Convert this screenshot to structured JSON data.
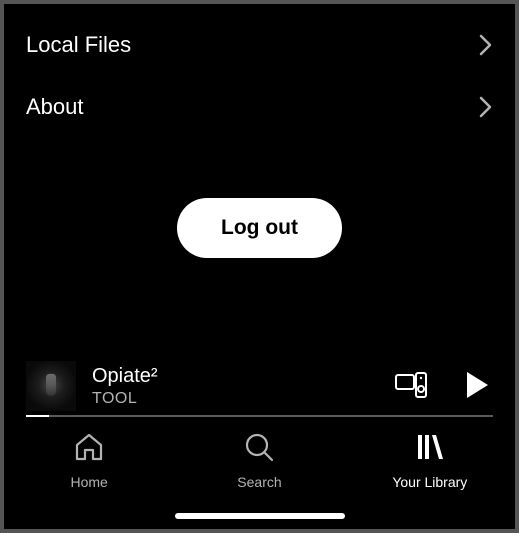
{
  "settings": {
    "items": [
      {
        "label": "Local Files"
      },
      {
        "label": "About"
      }
    ],
    "logout_label": "Log out"
  },
  "now_playing": {
    "title": "Opiate²",
    "artist": "TOOL",
    "progress_percent": 5
  },
  "nav": {
    "home": "Home",
    "search": "Search",
    "library": "Your Library",
    "active": "library"
  },
  "colors": {
    "background": "#000000",
    "text_primary": "#ffffff",
    "text_secondary": "#b3b3b3"
  }
}
